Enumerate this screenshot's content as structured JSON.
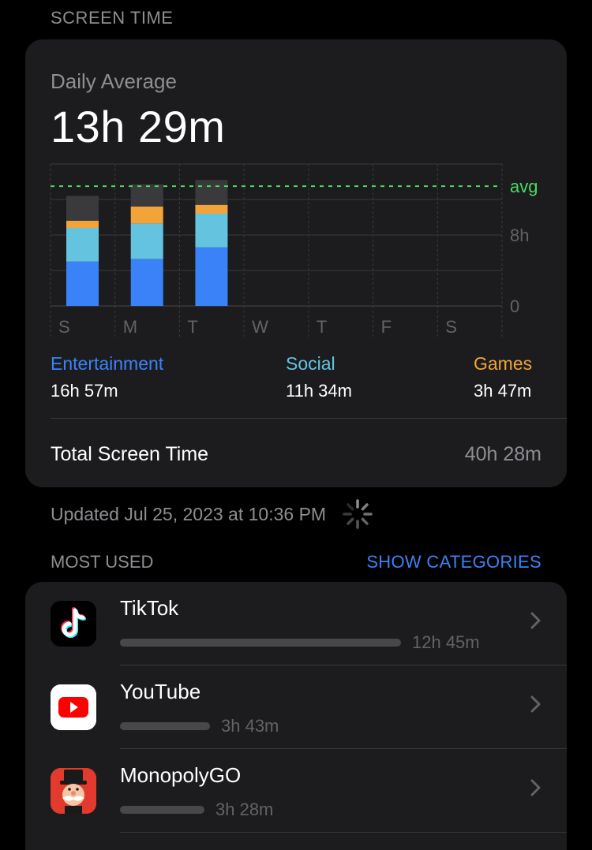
{
  "header": {
    "section_title": "SCREEN TIME"
  },
  "summary": {
    "daily_average_label": "Daily Average",
    "daily_average_value": "13h 29m"
  },
  "chart_data": {
    "type": "bar",
    "stacked": true,
    "categories": [
      "S",
      "M",
      "T",
      "W",
      "T",
      "F",
      "S"
    ],
    "y_tick_labels": [
      "0",
      "8h"
    ],
    "avg_label": "avg",
    "avg_value_hours": 13.5,
    "ylim_hours": [
      0,
      16
    ],
    "grid": true,
    "series": [
      {
        "name": "Entertainment",
        "color": "#3a82f7",
        "values": [
          5.0,
          5.3,
          6.6,
          0,
          0,
          0,
          0
        ]
      },
      {
        "name": "Social",
        "color": "#64c3df",
        "values": [
          3.8,
          4.0,
          3.8,
          0,
          0,
          0,
          0
        ]
      },
      {
        "name": "Games",
        "color": "#f2a33a",
        "values": [
          0.8,
          1.9,
          1.0,
          0,
          0,
          0,
          0
        ]
      },
      {
        "values": [
          2.8,
          2.5,
          2.8,
          0,
          0,
          0,
          0
        ],
        "color": "#3a3a3c"
      }
    ]
  },
  "categories": [
    {
      "name": "Entertainment",
      "value": "16h 57m",
      "color": "#3a82f7"
    },
    {
      "name": "Social",
      "value": "11h 34m",
      "color": "#64c3df"
    },
    {
      "name": "Games",
      "value": "3h 47m",
      "color": "#f2a33a"
    }
  ],
  "total": {
    "label": "Total Screen Time",
    "value": "40h 28m"
  },
  "updated_text": "Updated Jul 25, 2023 at 10:36 PM",
  "most_used": {
    "title": "MOST USED",
    "action": "SHOW CATEGORIES",
    "apps": [
      {
        "name": "TikTok",
        "time": "12h 45m",
        "fraction": 1.0,
        "icon": "tiktok-icon"
      },
      {
        "name": "YouTube",
        "time": "3h 43m",
        "fraction": 0.32,
        "icon": "youtube-icon"
      },
      {
        "name": "MonopolyGO",
        "time": "3h 28m",
        "fraction": 0.3,
        "icon": "monopoly-go-icon"
      }
    ]
  }
}
